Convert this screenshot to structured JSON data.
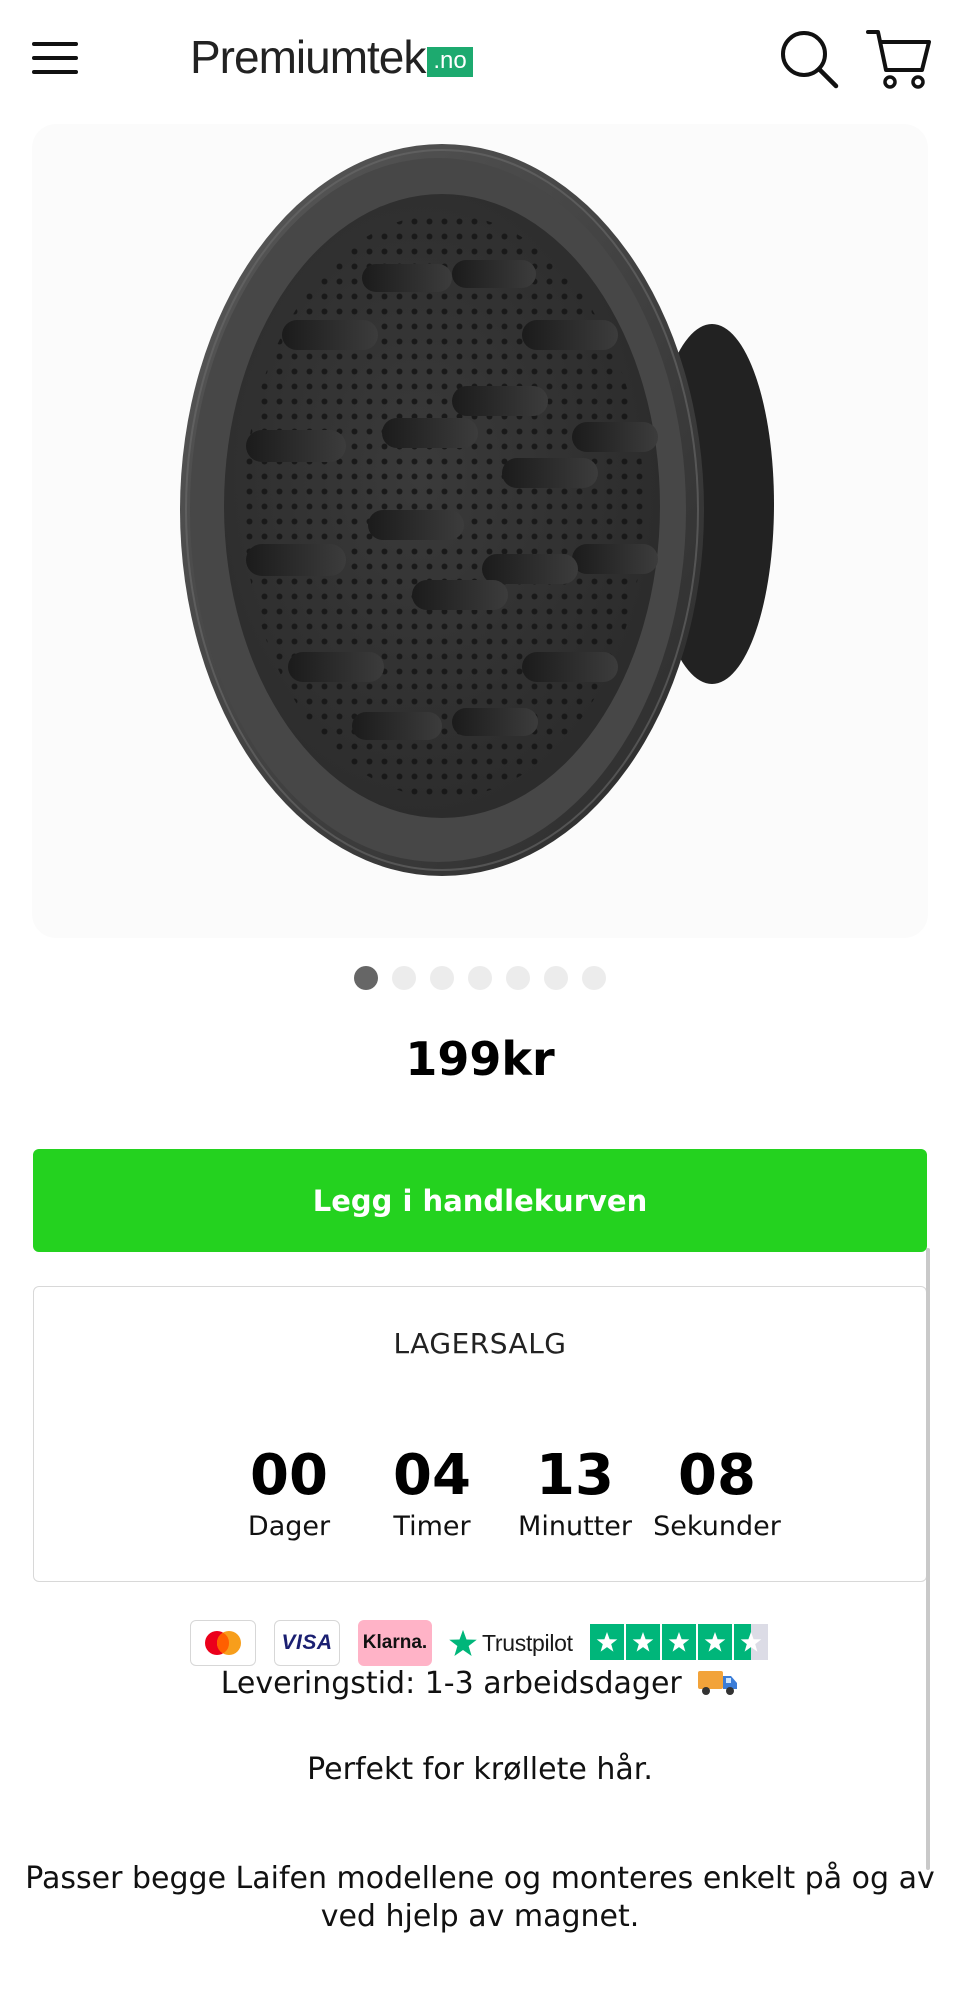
{
  "header": {
    "logo_text": "Premiumtek",
    "logo_badge": ".no",
    "menu_icon": "hamburger-icon",
    "search_icon": "search-icon",
    "cart_icon": "cart-icon"
  },
  "gallery": {
    "image_subject": "hair-diffuser-product-photo",
    "dot_count": 7,
    "active_index": 0
  },
  "product": {
    "price": "199kr",
    "add_to_cart_label": "Legg i handlekurven"
  },
  "sale": {
    "title": "LAGERSALG",
    "countdown": [
      {
        "value": "00",
        "label": "Dager"
      },
      {
        "value": "04",
        "label": "Timer"
      },
      {
        "value": "13",
        "label": "Minutter"
      },
      {
        "value": "08",
        "label": "Sekunder"
      }
    ]
  },
  "payments": {
    "mastercard_icon": "mastercard-icon",
    "visa": "VISA",
    "klarna": "Klarna.",
    "trustpilot": "Trustpilot",
    "trustpilot_rating": 4.5
  },
  "delivery": {
    "text": "Leveringstid: 1-3 arbeidsdager",
    "icon": "delivery-truck-icon"
  },
  "description": {
    "line1": "Perfekt for krøllete hår.",
    "line2": "Passer begge Laifen modellene og monteres enkelt på og av ved hjelp av magnet."
  },
  "colors": {
    "button_green": "#24d21f",
    "logo_badge_green": "#1daa6f",
    "trustpilot_green": "#00b67a",
    "klarna_pink": "#ffb3c7"
  }
}
